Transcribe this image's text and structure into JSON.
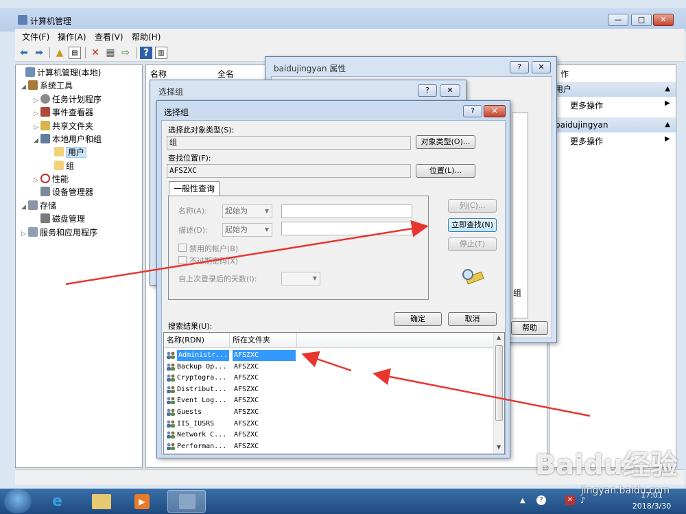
{
  "window": {
    "title": "计算机管理",
    "menu": [
      "文件(F)",
      "操作(A)",
      "查看(V)",
      "帮助(H)"
    ],
    "tree": [
      {
        "label": "计算机管理(本地)",
        "level": 0
      },
      {
        "label": "系统工具",
        "level": 1
      },
      {
        "label": "任务计划程序",
        "level": 2
      },
      {
        "label": "事件查看器",
        "level": 2
      },
      {
        "label": "共享文件夹",
        "level": 2
      },
      {
        "label": "本地用户和组",
        "level": 2
      },
      {
        "label": "用户",
        "level": 3
      },
      {
        "label": "组",
        "level": 3
      },
      {
        "label": "性能",
        "level": 2
      },
      {
        "label": "设备管理器",
        "level": 2
      },
      {
        "label": "存储",
        "level": 1
      },
      {
        "label": "磁盘管理",
        "level": 2
      },
      {
        "label": "服务和应用程序",
        "level": 1
      }
    ],
    "list_columns": [
      "名称",
      "全名"
    ],
    "actions": {
      "header": "作",
      "section1": "用户",
      "section1_item": "更多操作",
      "section2": "baidujingyan",
      "section2_item": "更多操作"
    }
  },
  "props_dialog": {
    "title": "baidujingyan 属性",
    "help_button": "帮助",
    "group_fragment": "组"
  },
  "select_group_back": {
    "title": "选择组"
  },
  "select_group": {
    "title": "选择组",
    "object_type_label": "选择此对象类型(S):",
    "object_type_value": "组",
    "object_type_button": "对象类型(O)...",
    "location_label": "查找位置(F):",
    "location_value": "AFSZXC",
    "location_button": "位置(L)...",
    "tab": "一般性查询",
    "name_label": "名称(A):",
    "name_mode": "起始为",
    "desc_label": "描述(D):",
    "desc_mode": "起始为",
    "disabled_accounts": "禁用的帐户(B)",
    "no_expire_pwd": "不过期密码(X)",
    "days_since_login": "自上次登录后的天数(I):",
    "columns_button": "列(C)...",
    "find_now_button": "立即查找(N)",
    "stop_button": "停止(T)",
    "ok_button": "确定",
    "cancel_button": "取消",
    "results_label": "搜索结果(U):",
    "results_columns": [
      "名称(RDN)",
      "所在文件夹"
    ],
    "results": [
      {
        "name": "Administr...",
        "folder": "AFSZXC",
        "selected": true
      },
      {
        "name": "Backup Op...",
        "folder": "AFSZXC"
      },
      {
        "name": "Cryptogra...",
        "folder": "AFSZXC"
      },
      {
        "name": "Distribut...",
        "folder": "AFSZXC"
      },
      {
        "name": "Event Log...",
        "folder": "AFSZXC"
      },
      {
        "name": "Guests",
        "folder": "AFSZXC"
      },
      {
        "name": "IIS_IUSRS",
        "folder": "AFSZXC"
      },
      {
        "name": "Network C...",
        "folder": "AFSZXC"
      },
      {
        "name": "Performan...",
        "folder": "AFSZXC"
      }
    ]
  },
  "taskbar": {
    "time": "17:01",
    "date": "2018/3/30"
  },
  "watermark": {
    "logo": "Baidu经验",
    "url": "jingyan.baidu.com"
  },
  "colors": {
    "selection": "#3399ff",
    "arrow": "#e8362f",
    "title_blue": "#b7cde9"
  }
}
